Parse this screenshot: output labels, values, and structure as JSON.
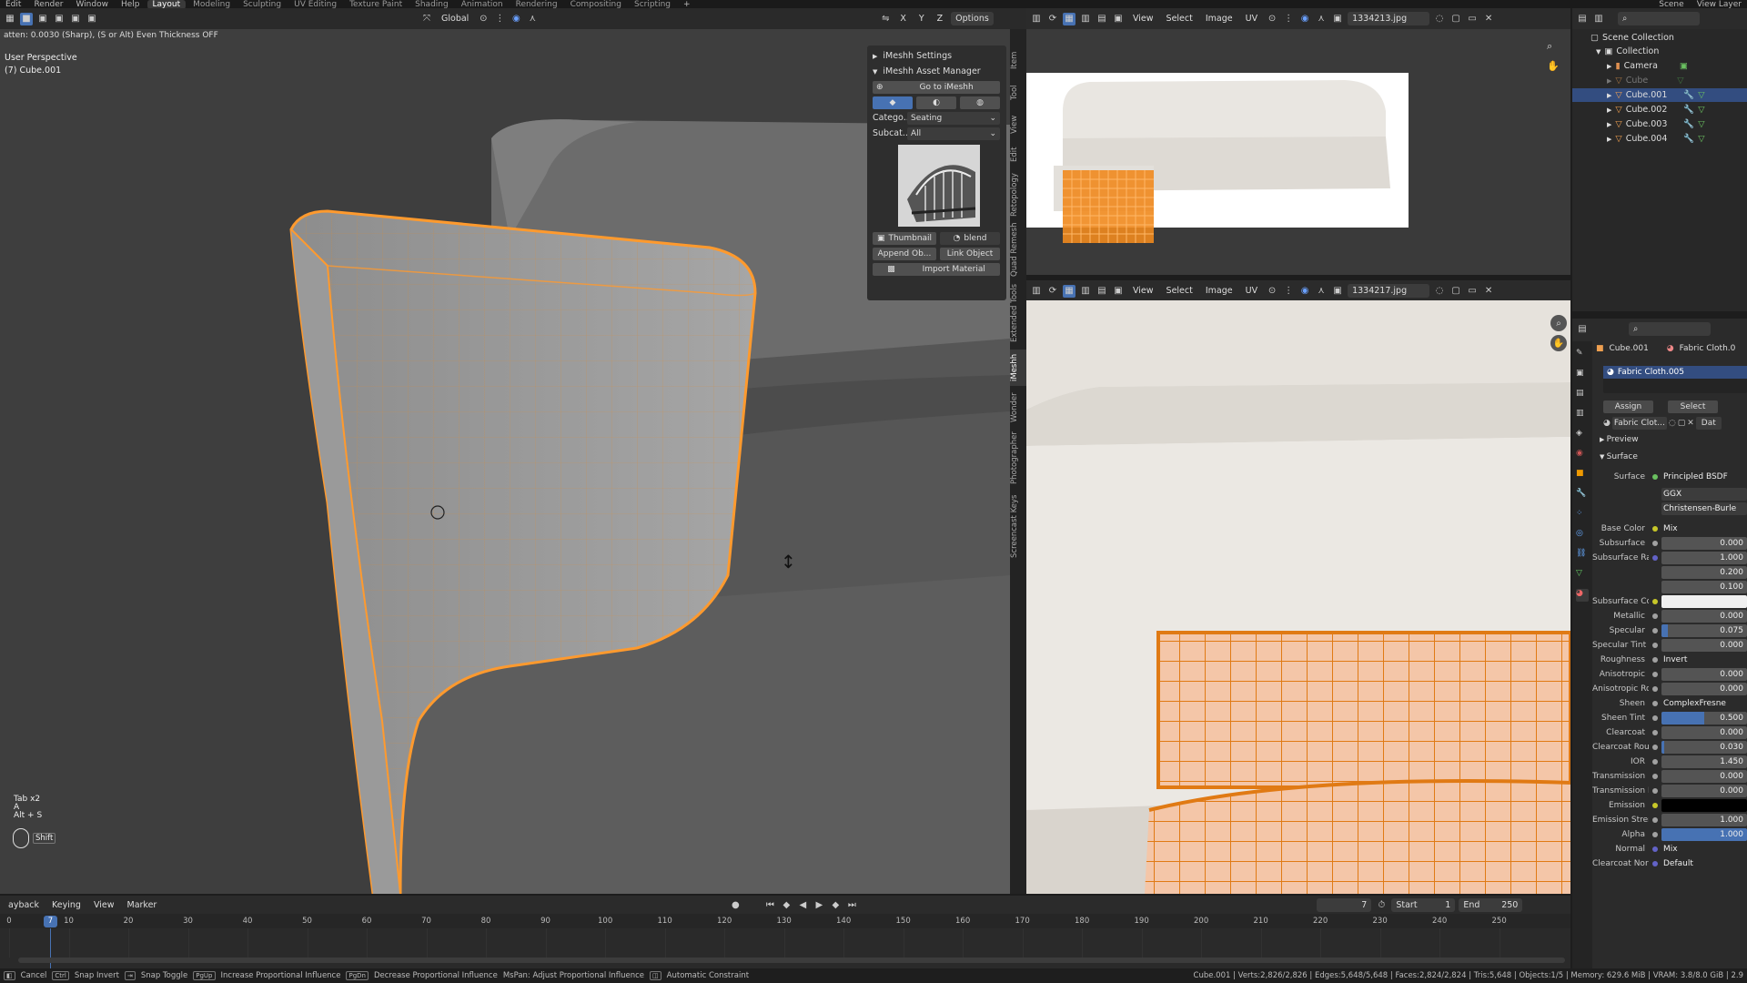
{
  "topbar": {
    "menus": [
      "Edit",
      "Render",
      "Window",
      "Help"
    ],
    "workspaces": [
      "Layout",
      "Modeling",
      "Sculpting",
      "UV Editing",
      "Texture Paint",
      "Shading",
      "Animation",
      "Rendering",
      "Compositing",
      "Scripting"
    ],
    "active_workspace": "Layout",
    "scene": "Scene",
    "view_layer": "View Layer"
  },
  "viewport": {
    "header": {
      "orientation": "Global",
      "axes": [
        "X",
        "Y",
        "Z"
      ],
      "options": "Options"
    },
    "operator_hint": "atten: 0.0030 (Sharp), (S or Alt) Even Thickness OFF",
    "perspective": "User Perspective",
    "object": "(7) Cube.001",
    "keys": [
      "Tab x2",
      "A",
      "Alt + S"
    ],
    "shift_key": "Shift",
    "side_tabs": [
      "Item",
      "Tool",
      "View",
      "Edit",
      "Retopology",
      "Quad Remesh",
      "Extended Tools",
      "iMeshh",
      "Wonder",
      "Photographer",
      "Screencast Keys"
    ]
  },
  "npanel": {
    "settings": "iMeshh Settings",
    "asset_manager": "iMeshh Asset Manager",
    "go_to": "Go to iMeshh",
    "category_label": "Catego...",
    "category_value": "Seating",
    "subcategory_label": "Subcat...",
    "subcategory_value": "All",
    "thumbnail": "Thumbnail",
    "blend": "blend",
    "append": "Append Ob...",
    "link": "Link Object",
    "import_material": "Import Material"
  },
  "image_editor_1": {
    "menus": [
      "View",
      "Select",
      "Image",
      "UV"
    ],
    "image_name": "1334213.jpg"
  },
  "image_editor_2": {
    "menus": [
      "View",
      "Select",
      "Image",
      "UV"
    ],
    "image_name": "1334217.jpg"
  },
  "outliner": {
    "scene_collection": "Scene Collection",
    "collection": "Collection",
    "items": [
      "Camera",
      "Cube",
      "Cube.001",
      "Cube.002",
      "Cube.003",
      "Cube.004"
    ],
    "selected": "Cube.001"
  },
  "properties": {
    "object": "Cube.001",
    "material": "Fabric Cloth.0",
    "slot": "Fabric Cloth.005",
    "assign": "Assign",
    "select": "Select",
    "material_field": "Fabric Clot...",
    "data": "Dat",
    "preview": "Preview",
    "surface_section": "Surface",
    "surface_label": "Surface",
    "surface_value": "Principled BSDF",
    "distribution": "GGX",
    "subsurface_method": "Christensen-Burle",
    "rows": [
      {
        "label": "Base Color",
        "value": "Mix",
        "kind": "text",
        "dot": "#c7c729"
      },
      {
        "label": "Subsurface",
        "value": "0.000",
        "kind": "num"
      },
      {
        "label": "Subsurface Radi...",
        "value": "1.000",
        "kind": "num",
        "dot": "#6363c7"
      },
      {
        "label": "",
        "value": "0.200",
        "kind": "num"
      },
      {
        "label": "",
        "value": "0.100",
        "kind": "num"
      },
      {
        "label": "Subsurface Color",
        "value": "",
        "kind": "color",
        "dot": "#c7c729"
      },
      {
        "label": "Metallic",
        "value": "0.000",
        "kind": "num"
      },
      {
        "label": "Specular",
        "value": "0.075",
        "kind": "num",
        "fill": 0.075
      },
      {
        "label": "Specular Tint",
        "value": "0.000",
        "kind": "num"
      },
      {
        "label": "Roughness",
        "value": "Invert",
        "kind": "text"
      },
      {
        "label": "Anisotropic",
        "value": "0.000",
        "kind": "num"
      },
      {
        "label": "Anisotropic Rota...",
        "value": "0.000",
        "kind": "num"
      },
      {
        "label": "Sheen",
        "value": "ComplexFresne",
        "kind": "text"
      },
      {
        "label": "Sheen Tint",
        "value": "0.500",
        "kind": "num",
        "fill": 0.5
      },
      {
        "label": "Clearcoat",
        "value": "0.000",
        "kind": "num"
      },
      {
        "label": "Clearcoat Rough...",
        "value": "0.030",
        "kind": "num",
        "fill": 0.03
      },
      {
        "label": "IOR",
        "value": "1.450",
        "kind": "num"
      },
      {
        "label": "Transmission",
        "value": "0.000",
        "kind": "num"
      },
      {
        "label": "Transmission Ro...",
        "value": "0.000",
        "kind": "num"
      },
      {
        "label": "Emission",
        "value": "",
        "kind": "black",
        "dot": "#c7c729"
      },
      {
        "label": "Emission Strength",
        "value": "1.000",
        "kind": "num"
      },
      {
        "label": "Alpha",
        "value": "1.000",
        "kind": "num",
        "fill": 1.0
      },
      {
        "label": "Normal",
        "value": "Mix",
        "kind": "text",
        "dot": "#6363c7"
      },
      {
        "label": "Clearcoat Normal",
        "value": "Default",
        "kind": "text",
        "dot": "#6363c7"
      }
    ]
  },
  "timeline": {
    "menus": [
      "ayback",
      "Keying",
      "View",
      "Marker"
    ],
    "current_frame": "7",
    "start_label": "Start",
    "start": "1",
    "end_label": "End",
    "end": "250",
    "ticks": [
      "0",
      "10",
      "20",
      "30",
      "40",
      "50",
      "60",
      "70",
      "80",
      "90",
      "100",
      "110",
      "120",
      "130",
      "140",
      "150",
      "160",
      "170",
      "180",
      "190",
      "200",
      "210",
      "220",
      "230",
      "240",
      "250"
    ]
  },
  "status": {
    "items": [
      "Cancel",
      "Snap Invert",
      "Snap Toggle",
      "Increase Proportional Influence",
      "Decrease Proportional Influence",
      "MsPan: Adjust Proportional Influence",
      "Automatic Constraint"
    ],
    "stats": "Cube.001 | Verts:2,826/2,826 | Edges:5,648/5,648 | Faces:2,824/2,824 | Tris:5,648 | Objects:1/5 | Memory: 629.6 MiB | VRAM: 3.8/8.0 GiB | 2.9"
  }
}
